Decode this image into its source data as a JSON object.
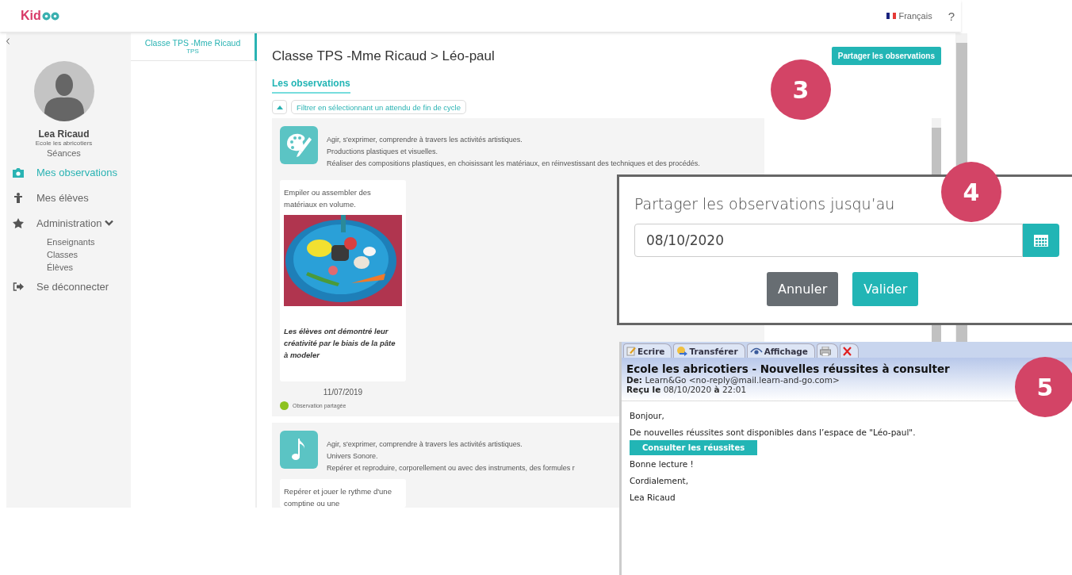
{
  "header": {
    "logo": "Kid",
    "language": "Français",
    "help": "?"
  },
  "sidebar": {
    "user_name": "Lea Ricaud",
    "school": "Ecole les abricotiers",
    "items": [
      {
        "label": "Séances",
        "kind": "sub",
        "selected": false
      },
      {
        "label": "Mes observations",
        "kind": "main",
        "selected": true
      },
      {
        "label": "Mes élèves",
        "kind": "main",
        "selected": false
      },
      {
        "label": "Administration",
        "kind": "main",
        "selected": false,
        "expanded": true,
        "children": [
          {
            "label": "Enseignants"
          },
          {
            "label": "Classes"
          },
          {
            "label": "Élèves"
          }
        ]
      },
      {
        "label": "Se déconnecter",
        "kind": "main",
        "selected": false
      }
    ]
  },
  "class_list": [
    {
      "title": "Classe TPS -Mme Ricaud",
      "subtitle": "TPS",
      "selected": true
    }
  ],
  "content": {
    "breadcrumb": "Classe TPS -Mme Ricaud > Léo-paul",
    "share_button": "Partager les observations",
    "tabs": [
      {
        "label": "Les observations",
        "selected": true
      }
    ],
    "filter": {
      "expanded": true,
      "label": "Filtrer en sélectionnant un attendu de fin de cycle"
    },
    "observations": [
      {
        "kind": "art",
        "lines": [
          "Agir, s'exprimer, comprendre à travers les activités artistiques.",
          "Productions plastiques et visuelles.",
          "Réaliser des compositions plastiques, en choisissant les matériaux, en réinvestissant des techniques et des procédés."
        ],
        "card": {
          "text": "Empiler ou assembler des matériaux en volume.",
          "caption": "Les élèves ont démontré leur créativité par le biais de la pâte à modeler"
        },
        "date": "11/07/2019",
        "status": {
          "label": "Observation partagée",
          "color": "#8dc21f"
        }
      },
      {
        "kind": "music",
        "lines": [
          "Agir, s'exprimer, comprendre à travers les activités artistiques.",
          "Univers Sonore.",
          "Repérer et reproduire, corporellement ou avec des instruments, des formules r"
        ],
        "card": {
          "text": "Repérer et jouer le rythme d'une comptine ou une"
        }
      }
    ]
  },
  "share_dialog": {
    "title": "Partager les observations jusqu’au",
    "date": "08/10/2020",
    "buttons": [
      {
        "label": "Annuler",
        "kind": "cancel"
      },
      {
        "label": "Valider",
        "kind": "confirm"
      }
    ]
  },
  "email": {
    "toolbar": [
      {
        "label": "Ecrire",
        "kind": "write"
      },
      {
        "label": "Transférer",
        "kind": "forward"
      },
      {
        "label": "Affichage",
        "kind": "view"
      },
      {
        "kind": "print"
      },
      {
        "kind": "delete"
      }
    ],
    "subject": "Ecole les abricotiers - Nouvelles réussites à consulter",
    "from_label": "De:",
    "from": "Learn&Go <no-reply@mail.learn-and-go.com>",
    "received_label": "Reçu le",
    "received": "08/10/2020 **à** 22:01",
    "body": [
      {
        "kind": "text",
        "text": "Bonjour,"
      },
      {
        "kind": "text",
        "text": "De nouvelles réussites sont disponibles dans l’espace de \"Léo-paul\"."
      },
      {
        "kind": "button",
        "text": "Consulter les réussites"
      },
      {
        "kind": "text",
        "text": "Bonne lecture !"
      },
      {
        "kind": "text",
        "text": "Cordialement,"
      },
      {
        "kind": "text",
        "text": "Lea Ricaud"
      }
    ]
  },
  "step_badges": [
    "3",
    "4",
    "5"
  ]
}
